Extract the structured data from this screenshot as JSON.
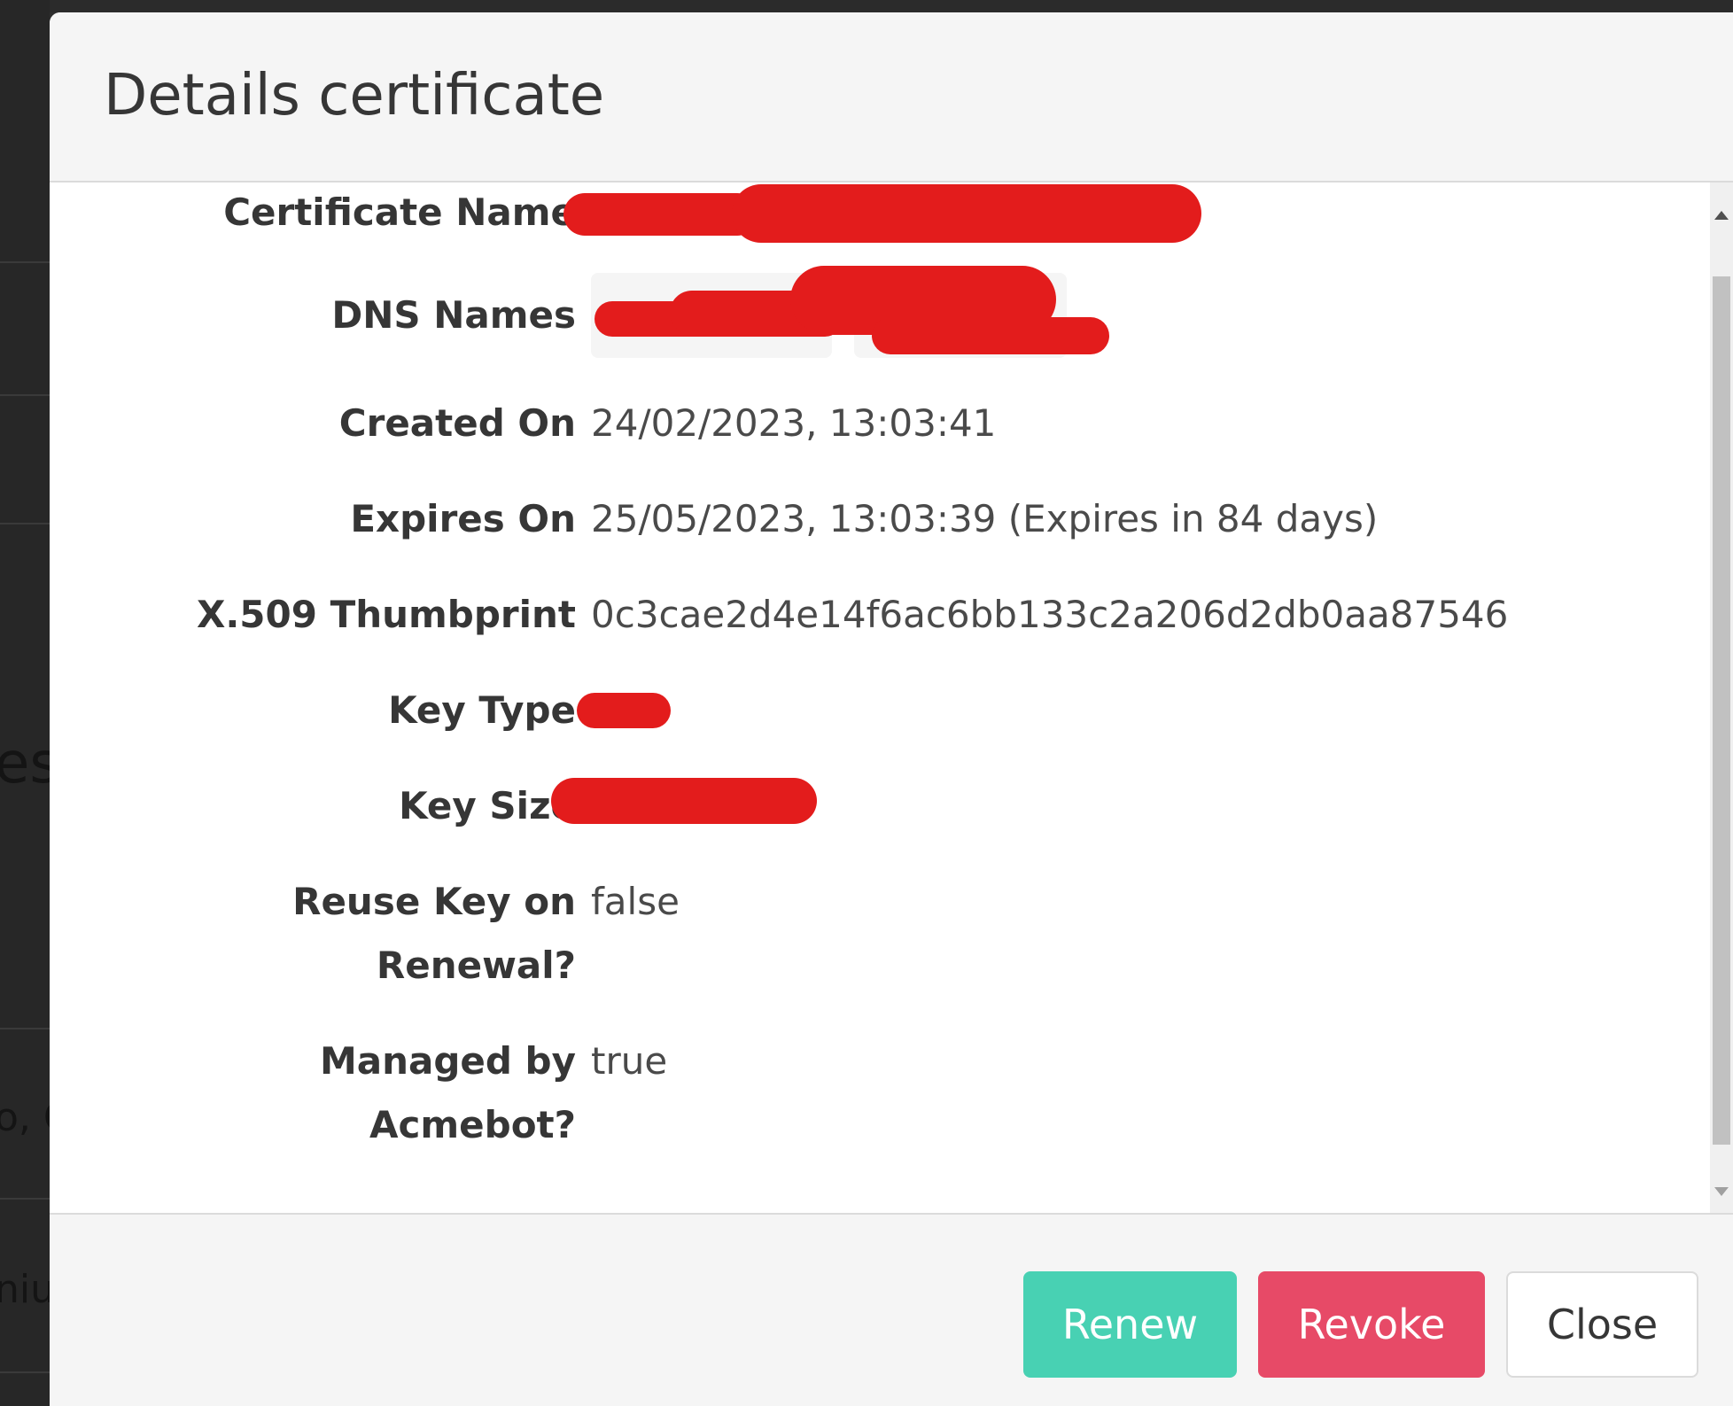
{
  "modal": {
    "title": "Details certificate"
  },
  "details": {
    "certificate_name_label": "Certificate Name",
    "dns_names_label": "DNS Names",
    "created_on_label": "Created On",
    "created_on_value": "24/02/2023, 13:03:41",
    "expires_on_label": "Expires On",
    "expires_on_value": "25/05/2023, 13:03:39 (Expires in 84 days)",
    "thumbprint_label": "X.509 Thumbprint",
    "thumbprint_value": "0c3cae2d4e14f6ac6bb133c2a206d2db0aa87546",
    "key_type_label": "Key Type",
    "key_size_label": "Key Size",
    "reuse_key_label_line1": "Reuse Key on",
    "reuse_key_label_line2": "Renewal?",
    "reuse_key_value": "false",
    "managed_label_line1": "Managed by",
    "managed_label_line2": "Acmebot?",
    "managed_value": "true"
  },
  "footer": {
    "renew_label": "Renew",
    "revoke_label": "Revoke",
    "close_label": "Close"
  },
  "background": {
    "partial_text_1": "es",
    "partial_text_2": "o, C",
    "partial_text_3": "niu"
  },
  "colors": {
    "renew": "#48d1b3",
    "revoke": "#e74a67",
    "redaction": "#e31c1c",
    "title_text": "#363636",
    "value_text": "#4a4a4a"
  }
}
